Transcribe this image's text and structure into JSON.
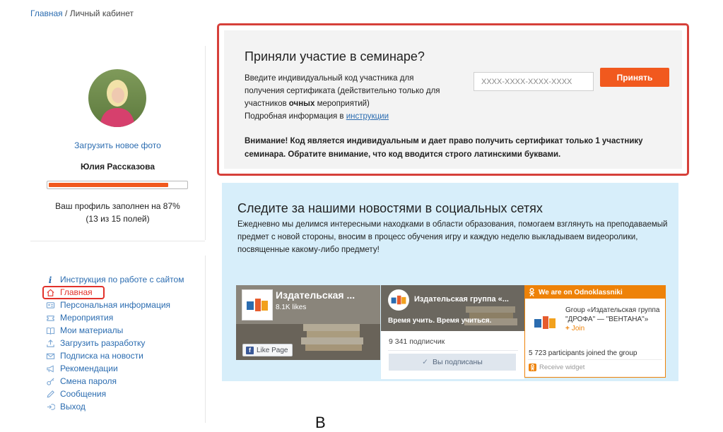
{
  "breadcrumb": {
    "home": "Главная",
    "separator": "/",
    "current": "Личный кабинет"
  },
  "profile": {
    "upload_photo": "Загрузить новое фото",
    "name": "Юлия Рассказова",
    "progress_percent": 87,
    "filled_line1": "Ваш профиль заполнен на 87%",
    "filled_line2": "(13 из 15 полей)"
  },
  "nav": [
    {
      "label": "Инструкция по работе с сайтом",
      "icon": "info-icon",
      "active": false
    },
    {
      "label": "Главная",
      "icon": "home-icon",
      "active": true
    },
    {
      "label": "Персональная информация",
      "icon": "id-card-icon",
      "active": false
    },
    {
      "label": "Мероприятия",
      "icon": "ticket-icon",
      "active": false
    },
    {
      "label": "Мои материалы",
      "icon": "book-icon",
      "active": false
    },
    {
      "label": "Загрузить разработку",
      "icon": "upload-icon",
      "active": false
    },
    {
      "label": "Подписка на новости",
      "icon": "mail-icon",
      "active": false
    },
    {
      "label": "Рекомендации",
      "icon": "megaphone-icon",
      "active": false
    },
    {
      "label": "Смена пароля",
      "icon": "key-icon",
      "active": false
    },
    {
      "label": "Сообщения",
      "icon": "pencil-icon",
      "active": false
    },
    {
      "label": "Выход",
      "icon": "logout-icon",
      "active": false
    }
  ],
  "seminar": {
    "title": "Приняли участие в семинаре?",
    "desc_part1": "Введите индивидуальный код участника для получения сертификата (действительно только для участников ",
    "desc_bold": "очных",
    "desc_part2": " мероприятий)",
    "more_info": "Подробная информация в ",
    "more_link": "инструкции",
    "code_placeholder": "XXXX-XXXX-XXXX-XXXX",
    "accept_button": "Принять",
    "warning": "Внимание! Код является индивидуальным и дает право получить сертификат только 1 участнику семинара. Обратите внимание, что код вводится строго латинскими буквами."
  },
  "social": {
    "title": "Следите за нашими новостями в социальных сетях",
    "description": "Ежедневно мы делимся интересными находками в области образования, помогаем взглянуть на преподаваемый предмет с новой стороны, вносим в процесс обучения игру и каждую неделю выкладываем видеоролики, посвященные какому-либо предмету!",
    "facebook": {
      "name": "Издательская ...",
      "likes": "8.1K likes",
      "like_button": "Like Page",
      "f_glyph": "f"
    },
    "vk": {
      "name": "Издательская группа «...",
      "slogan": "Время учить. Время учиться.",
      "subscribers": "9 341 подписчик",
      "subscribed_button": "Вы подписаны",
      "check_glyph": "✓"
    },
    "ok": {
      "header": "We are on Odnoklassniki",
      "group": "Group «Издательская группа \"ДРОФА\" — \"ВЕНТАНА\"»",
      "join": "Join",
      "plus_glyph": "+",
      "participants": "5 723 participants joined the group",
      "receive": "Receive widget"
    },
    "brand_colors": {
      "facebook": "#3b5998",
      "ok": "#ee8208",
      "vk_button": "#dfe6ee"
    }
  },
  "colors": {
    "accent": "#f1591e",
    "link": "#2b6cb0",
    "highlight_border": "#e2312a"
  },
  "bottom_partial": "В"
}
